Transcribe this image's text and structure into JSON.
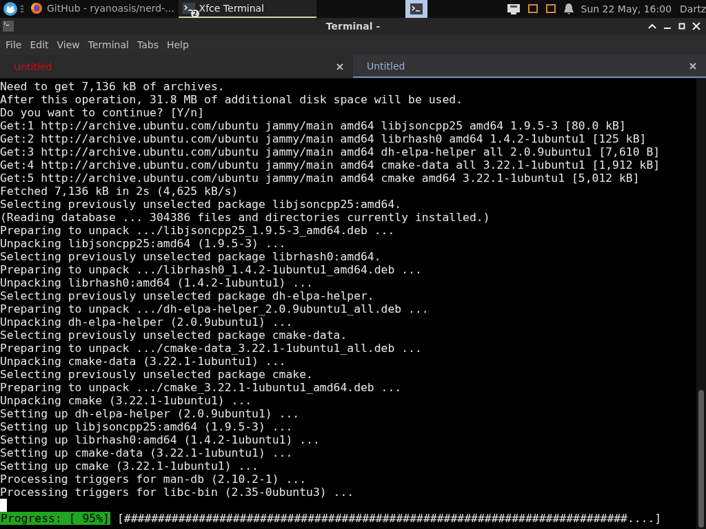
{
  "panel": {
    "tasks": [
      {
        "kind": "browser",
        "label": "GitHub - ryanoasis/nerd-...",
        "selected": false
      },
      {
        "kind": "terminal",
        "label": "Xfce Terminal",
        "badge": "2",
        "selected": true
      }
    ],
    "clock": "Sun 22 May, 16:00",
    "user": "Dartz"
  },
  "window": {
    "title": "Terminal -"
  },
  "menu": [
    "File",
    "Edit",
    "View",
    "Terminal",
    "Tabs",
    "Help"
  ],
  "tabs": [
    {
      "label": "Untitled",
      "selected": false,
      "activity": true
    },
    {
      "label": "Untitled",
      "selected": true,
      "activity": false
    }
  ],
  "terminal": {
    "lines": [
      "Need to get 7,136 kB of archives.",
      "After this operation, 31.8 MB of additional disk space will be used.",
      "Do you want to continue? [Y/n]",
      "Get:1 http://archive.ubuntu.com/ubuntu jammy/main amd64 libjsoncpp25 amd64 1.9.5-3 [80.0 kB]",
      "Get:2 http://archive.ubuntu.com/ubuntu jammy/main amd64 librhash0 amd64 1.4.2-1ubuntu1 [125 kB]",
      "Get:3 http://archive.ubuntu.com/ubuntu jammy/main amd64 dh-elpa-helper all 2.0.9ubuntu1 [7,610 B]",
      "Get:4 http://archive.ubuntu.com/ubuntu jammy/main amd64 cmake-data all 3.22.1-1ubuntu1 [1,912 kB]",
      "Get:5 http://archive.ubuntu.com/ubuntu jammy/main amd64 cmake amd64 3.22.1-1ubuntu1 [5,012 kB]",
      "Fetched 7,136 kB in 2s (4,625 kB/s)",
      "Selecting previously unselected package libjsoncpp25:amd64.",
      "(Reading database ... 304386 files and directories currently installed.)",
      "Preparing to unpack .../libjsoncpp25_1.9.5-3_amd64.deb ...",
      "Unpacking libjsoncpp25:amd64 (1.9.5-3) ...",
      "Selecting previously unselected package librhash0:amd64.",
      "Preparing to unpack .../librhash0_1.4.2-1ubuntu1_amd64.deb ...",
      "Unpacking librhash0:amd64 (1.4.2-1ubuntu1) ...",
      "Selecting previously unselected package dh-elpa-helper.",
      "Preparing to unpack .../dh-elpa-helper_2.0.9ubuntu1_all.deb ...",
      "Unpacking dh-elpa-helper (2.0.9ubuntu1) ...",
      "Selecting previously unselected package cmake-data.",
      "Preparing to unpack .../cmake-data_3.22.1-1ubuntu1_all.deb ...",
      "Unpacking cmake-data (3.22.1-1ubuntu1) ...",
      "Selecting previously unselected package cmake.",
      "Preparing to unpack .../cmake_3.22.1-1ubuntu1_amd64.deb ...",
      "Unpacking cmake (3.22.1-1ubuntu1) ...",
      "Setting up dh-elpa-helper (2.0.9ubuntu1) ...",
      "Setting up libjsoncpp25:amd64 (1.9.5-3) ...",
      "Setting up librhash0:amd64 (1.4.2-1ubuntu1) ...",
      "Setting up cmake-data (3.22.1-1ubuntu1) ...",
      "Setting up cmake (3.22.1-1ubuntu1) ...",
      "Processing triggers for man-db (2.10.2-1) ...",
      "Processing triggers for libc-bin (2.35-0ubuntu3) ..."
    ],
    "progress_label": "Progress: [ 95%]",
    "progress_bar": "[##########################################################################....]"
  }
}
